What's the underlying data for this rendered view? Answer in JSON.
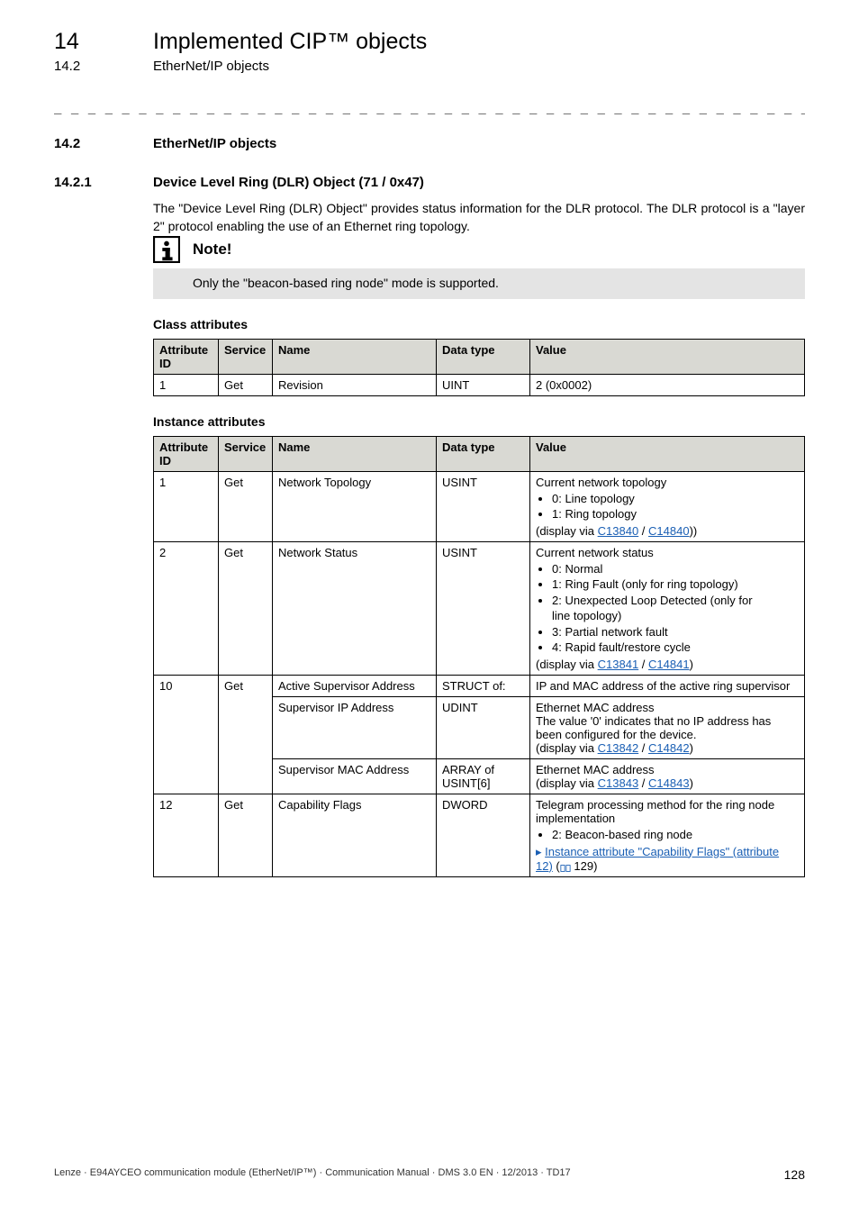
{
  "header": {
    "chapter_num": "14",
    "chapter_title": "Implemented CIP™ objects",
    "section_num": "14.2",
    "section_title": "EtherNet/IP objects",
    "dashes": "_ _ _ _ _ _ _ _ _ _ _ _ _ _ _ _ _ _ _ _ _ _ _ _ _ _ _ _ _ _ _ _ _ _ _ _ _ _ _ _ _ _ _ _ _ _ _ _ _ _ _ _ _ _ _ _ _ _ _ _ _ _ _ _"
  },
  "s14_2": {
    "num": "14.2",
    "title": "EtherNet/IP objects"
  },
  "s14_2_1": {
    "num": "14.2.1",
    "title": "Device Level Ring (DLR) Object (71 / 0x47)",
    "para": "The \"Device Level Ring (DLR) Object\" provides status information for the DLR protocol. The DLR protocol is a \"layer 2\" protocol enabling the use of an Ethernet ring topology."
  },
  "note": {
    "title": "Note!",
    "text": "Only the \"beacon-based ring node\" mode is supported."
  },
  "class_attr": {
    "heading": "Class attributes",
    "headers": {
      "attr": "Attribute ID",
      "svc": "Service",
      "name": "Name",
      "dt": "Data type",
      "val": "Value"
    },
    "rows": [
      {
        "attr": "1",
        "svc": "Get",
        "name": "Revision",
        "dt": "UINT",
        "val": "2 (0x0002)"
      }
    ]
  },
  "inst_attr": {
    "heading": "Instance attributes",
    "headers": {
      "attr": "Attribute ID",
      "svc": "Service",
      "name": "Name",
      "dt": "Data type",
      "val": "Value"
    },
    "row1": {
      "attr": "1",
      "svc": "Get",
      "name": "Network Topology",
      "dt": "USINT",
      "line1": "Current network topology",
      "b1": "0: Line topology",
      "b2": "1: Ring topology",
      "disp_pre": "(display via ",
      "link1": "C13840",
      "sep": " / ",
      "link2": "C14840",
      "disp_post": "))"
    },
    "row2": {
      "attr": "2",
      "svc": "Get",
      "name": "Network Status",
      "dt": "USINT",
      "line1": "Current network status",
      "b1": "0: Normal",
      "b2": "1: Ring Fault (only for ring topology)",
      "b3a": "2: Unexpected Loop Detected (only for",
      "b3b": "line topology)",
      "b4": "3: Partial network fault",
      "b5": "4: Rapid fault/restore cycle",
      "disp_pre": "(display via ",
      "link1": "C13841",
      "sep": " / ",
      "link2": "C14841",
      "disp_post": ")"
    },
    "row10a": {
      "attr": "10",
      "svc": "Get",
      "name": "Active Supervisor Address",
      "dt": "STRUCT of:",
      "val": "IP and MAC address of the active ring supervisor"
    },
    "row10b": {
      "name": "Supervisor IP Address",
      "dt": "UDINT",
      "l1": "Ethernet MAC address",
      "l2": "The value '0' indicates that no IP address has been configured for the device.",
      "disp_pre": "(display via ",
      "link1": "C13842",
      "sep": " / ",
      "link2": "C14842",
      "disp_post": ")"
    },
    "row10c": {
      "name": "Supervisor MAC Address",
      "dt": "ARRAY of USINT[6]",
      "l1": "Ethernet MAC address",
      "disp_pre": "(display via ",
      "link1": "C13843",
      "sep": " / ",
      "link2": "C14843",
      "disp_post": ")"
    },
    "row12": {
      "attr": "12",
      "svc": "Get",
      "name": "Capability Flags",
      "dt": "DWORD",
      "l1": "Telegram processing method for the ring node implementation",
      "b1": "2: Beacon-based ring node",
      "link_text": "Instance attribute \"Capability Flags\" (attribute 12)",
      "page_ref": " 129)"
    }
  },
  "footer": {
    "text": "Lenze · E94AYCEO communication module (EtherNet/IP™) · Communication Manual · DMS 3.0 EN · 12/2013 · TD17",
    "page": "128"
  }
}
